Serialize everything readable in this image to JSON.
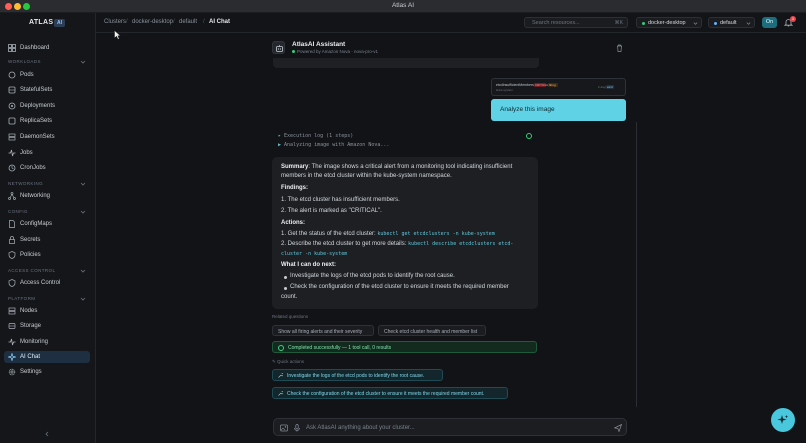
{
  "window": {
    "title": "Atlas AI"
  },
  "colors": {
    "accent": "#5fd2e6",
    "success": "#2fd07a",
    "danger": "#e5484d",
    "sidebar_active": "#1d2f40"
  },
  "brand": {
    "name": "ATLAS",
    "badge": "AI"
  },
  "sidebar": {
    "top": [
      {
        "label": "Dashboard",
        "icon": "dashboard-icon"
      }
    ],
    "sections": [
      {
        "title": "WORKLOADS",
        "items": [
          {
            "label": "Pods",
            "icon": "pod-icon"
          },
          {
            "label": "StatefulSets",
            "icon": "database-icon"
          },
          {
            "label": "Deployments",
            "icon": "deploy-icon"
          },
          {
            "label": "ReplicaSets",
            "icon": "layers-icon"
          },
          {
            "label": "DaemonSets",
            "icon": "server-icon"
          },
          {
            "label": "Jobs",
            "icon": "activity-icon"
          },
          {
            "label": "CronJobs",
            "icon": "clock-icon"
          }
        ]
      },
      {
        "title": "NETWORKING",
        "items": [
          {
            "label": "Networking",
            "icon": "network-icon"
          }
        ]
      },
      {
        "title": "CONFIG",
        "items": [
          {
            "label": "ConfigMaps",
            "icon": "file-icon"
          },
          {
            "label": "Secrets",
            "icon": "lock-icon"
          },
          {
            "label": "Policies",
            "icon": "shield-icon"
          }
        ]
      },
      {
        "title": "ACCESS CONTROL",
        "items": [
          {
            "label": "Access Control",
            "icon": "shield-icon"
          }
        ]
      },
      {
        "title": "PLATFORM",
        "items": [
          {
            "label": "Nodes",
            "icon": "server-icon"
          },
          {
            "label": "Storage",
            "icon": "storage-icon"
          },
          {
            "label": "Monitoring",
            "icon": "activity-icon"
          },
          {
            "label": "AI Chat",
            "icon": "sparkle-icon",
            "active": true
          },
          {
            "label": "Settings",
            "icon": "gear-icon"
          }
        ]
      }
    ]
  },
  "header": {
    "breadcrumb": [
      "Clusters",
      "docker-desktop",
      "default",
      "AI Chat"
    ],
    "search_placeholder": "Search resources...",
    "search_shortcut": "⌘K",
    "cluster": "docker-desktop",
    "namespace": "default",
    "toggle_label": "On",
    "notification_count": "1"
  },
  "chat": {
    "title": "AtlasAI Assistant",
    "subtitle": "Powered by Amazon Nova · nova-pro-v1",
    "attachment_preview": {
      "name": "etcdInsufficientMembers",
      "badge1": "CRITICAL",
      "badge2": "firing",
      "sub": "kube-system",
      "time": "2 days ago",
      "tag": "etcd"
    },
    "user_message": "Analyze this image",
    "exec_log": {
      "title": "Execution log (1 steps)",
      "step": "Analyzing image with Amazon Nova..."
    },
    "answer": {
      "summary_label": "Summary",
      "summary_line1": ": The image shows a critical alert from a monitoring tool indicating insufficient",
      "summary_line2": "members in the etcd cluster within the kube-system namespace.",
      "findings_label": "Findings",
      "findings": [
        "1. The etcd cluster has insufficient members.",
        "2. The alert is marked as \"CRITICAL\"."
      ],
      "actions_label": "Actions",
      "action1_text": "1. Get the status of the etcd cluster:",
      "action1_code": "kubectl get etcdclusters -n kube-system",
      "action2_text": "2. Describe the etcd cluster to get more details:",
      "action2_code_a": "kubectl describe etcdclusters etcd-",
      "action2_code_b": "cluster -n kube-system",
      "next_label": "What I can do next",
      "next_items": [
        "Investigate the logs of the etcd pods to identify the root cause.",
        "Check the configuration of the etcd cluster to ensure it meets the required member",
        "count."
      ]
    },
    "related_label": "Related questions",
    "related": [
      "Show all firing alerts and their severity",
      "Check etcd cluster health and member list"
    ],
    "success_text": "Completed successfully — 1 tool call, 0 results",
    "quick_actions_label": "Quick actions",
    "quick_actions": [
      "Investigate the logs of the etcd pods to identify the root cause.",
      "Check the configuration of the etcd cluster to ensure it meets the required member count."
    ],
    "composer_placeholder": "Ask AtlasAI anything about your cluster..."
  }
}
